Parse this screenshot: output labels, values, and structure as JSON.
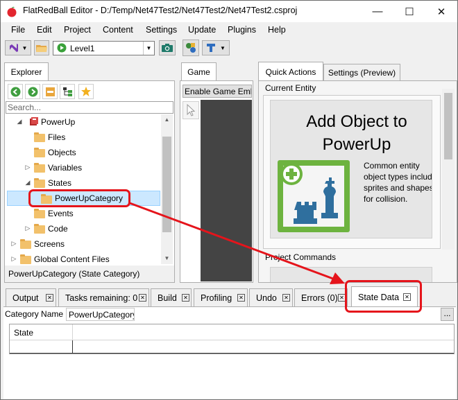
{
  "window": {
    "title": "FlatRedBall Editor - D:/Temp/Net47Test2/Net47Test2/Net47Test2.csproj"
  },
  "menu": [
    "File",
    "Edit",
    "Project",
    "Content",
    "Settings",
    "Update",
    "Plugins",
    "Help"
  ],
  "toolbar": {
    "combo_value": "Level1"
  },
  "explorer": {
    "tab": "Explorer",
    "search_placeholder": "Search...",
    "tree": [
      {
        "label": "PowerUp",
        "depth": 2,
        "expanded": true,
        "icon": "entity-icon"
      },
      {
        "label": "Files",
        "depth": 3,
        "icon": "folder-icon"
      },
      {
        "label": "Objects",
        "depth": 3,
        "icon": "folder-icon"
      },
      {
        "label": "Variables",
        "depth": 3,
        "icon": "folder-icon",
        "collapsed": true
      },
      {
        "label": "States",
        "depth": 3,
        "icon": "folder-icon",
        "expanded": true
      },
      {
        "label": "PowerUpCategory",
        "depth": 4,
        "icon": "folder-icon",
        "selected": true
      },
      {
        "label": "Events",
        "depth": 3,
        "icon": "folder-icon"
      },
      {
        "label": "Code",
        "depth": 3,
        "icon": "folder-icon",
        "collapsed": true
      },
      {
        "label": "Screens",
        "depth": 1,
        "icon": "folder-icon",
        "collapsed": true
      },
      {
        "label": "Global Content Files",
        "depth": 1,
        "icon": "folder-icon",
        "collapsed": true
      }
    ],
    "status": "PowerUpCategory (State Category)"
  },
  "game": {
    "tab": "Game",
    "embed_button": "Enable Game Emb"
  },
  "quick_actions": {
    "tabs": [
      "Quick Actions",
      "Settings (Preview)"
    ],
    "current_entity": "Current Entity",
    "add_object_title": "Add Object to PowerUp",
    "add_object_desc": "Common entity object types includ sprites and shapes for collision.",
    "project_commands": "Project Commands"
  },
  "bottom_tabs": [
    "Output",
    "Tasks remaining: 0",
    "Build",
    "Profiling",
    "Undo",
    "Errors (0)",
    "State Data"
  ],
  "state_data": {
    "category_label": "Category Name",
    "category_value": "PowerUpCategory",
    "ellipsis": "...",
    "column_header": "State"
  },
  "colors": {
    "callout": "#e5141b",
    "selection": "#cce8ff",
    "accent_green": "#6db33f"
  }
}
